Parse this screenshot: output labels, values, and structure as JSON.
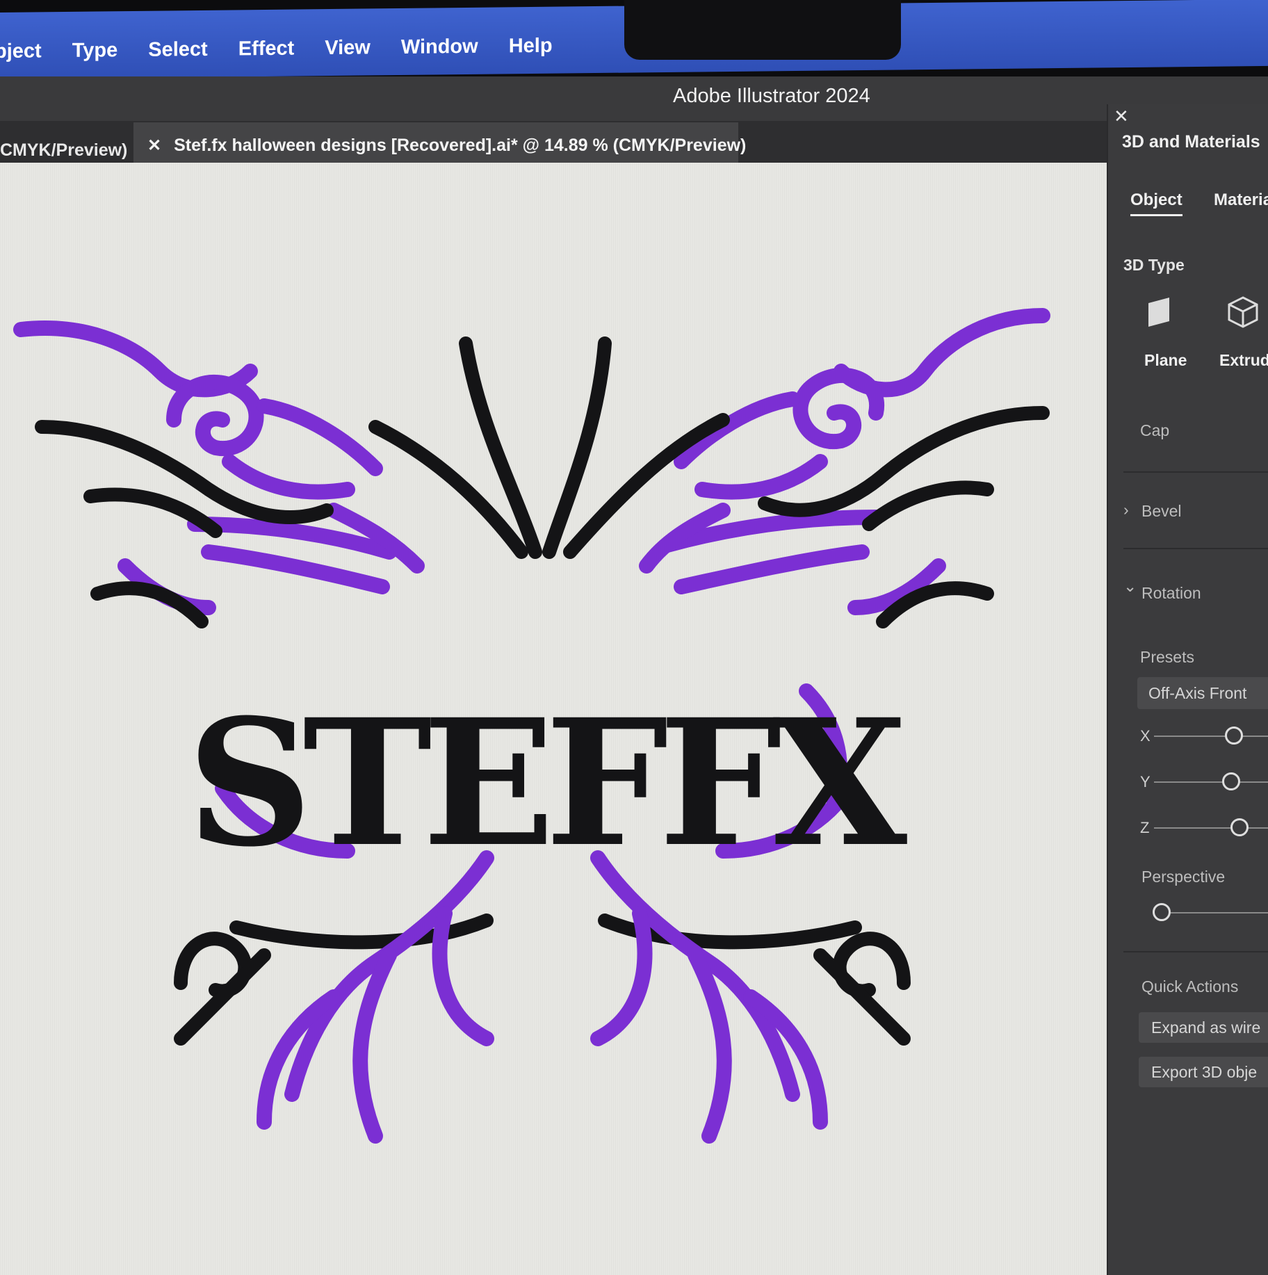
{
  "menubar": {
    "items": [
      {
        "label": "bject"
      },
      {
        "label": "Type"
      },
      {
        "label": "Select"
      },
      {
        "label": "Effect"
      },
      {
        "label": "View"
      },
      {
        "label": "Window"
      },
      {
        "label": "Help"
      }
    ]
  },
  "window": {
    "app_title": "Adobe Illustrator 2024"
  },
  "tabs": {
    "inactive_label": "CMYK/Preview)",
    "active_close": "✕",
    "active_label": "Stef.fx halloween designs [Recovered].ai* @ 14.89 % (CMYK/Preview)"
  },
  "artwork": {
    "text": "STEFFX",
    "colors": {
      "purple": "#7b2fd3",
      "black": "#141416",
      "canvas": "#e7e7e3"
    }
  },
  "panel": {
    "close": "✕",
    "title": "3D and Materials",
    "tabs": [
      "Object",
      "Materia"
    ],
    "type_heading": "3D Type",
    "types": [
      {
        "label": "Plane",
        "icon": "plane-icon"
      },
      {
        "label": "Extrud",
        "icon": "extrude-cube-icon"
      }
    ],
    "cap_label": "Cap",
    "bevel_label": "Bevel",
    "rotation_label": "Rotation",
    "presets_label": "Presets",
    "preset_value": "Off-Axis Front",
    "axes": [
      "X",
      "Y",
      "Z"
    ],
    "perspective_label": "Perspective",
    "quick_actions_label": "Quick Actions",
    "expand_button": "Expand as wire",
    "export_button": "Export 3D obje",
    "chevron_right": "›",
    "chevron_down": "⌄"
  }
}
